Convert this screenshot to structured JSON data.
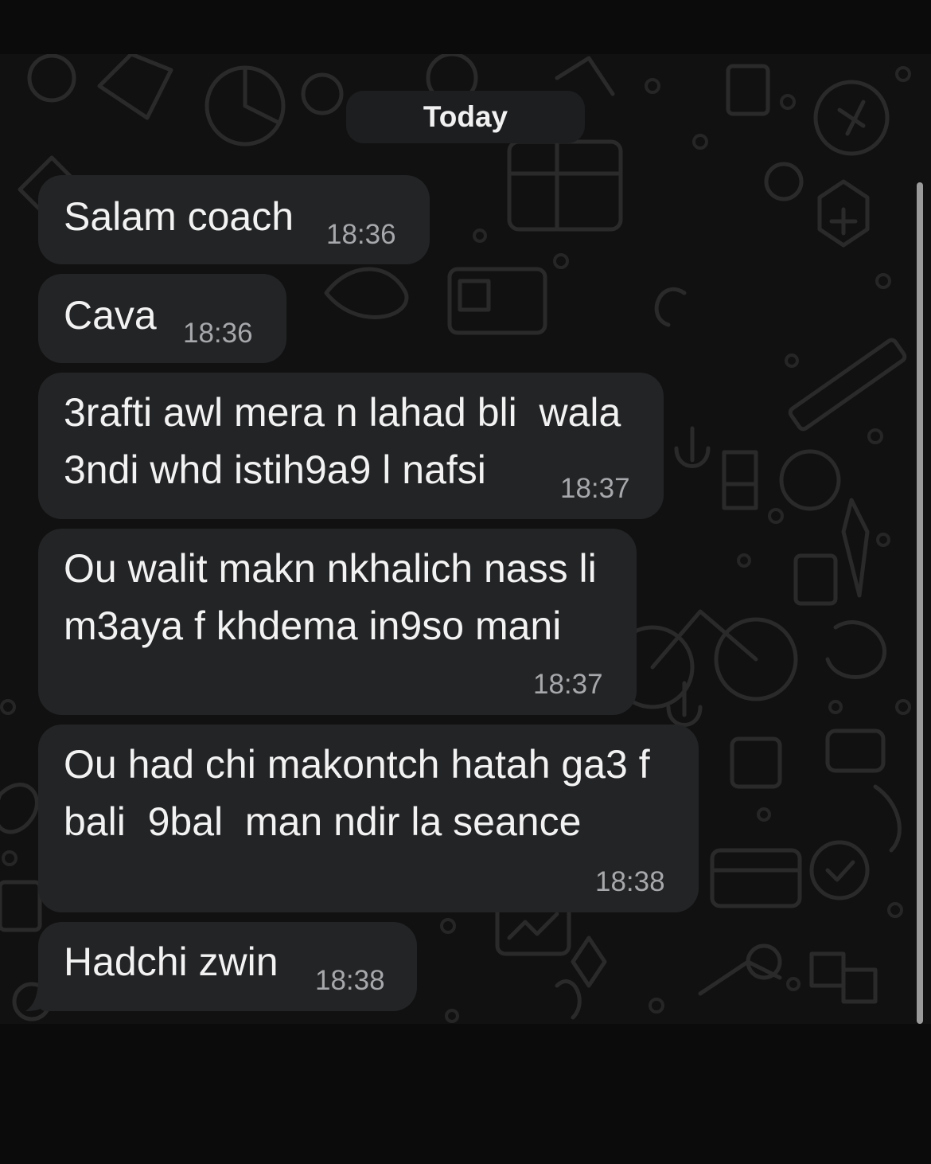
{
  "date_separator": "Today",
  "messages": [
    {
      "lines": [
        "Salam coach"
      ],
      "time": "18:36"
    },
    {
      "lines": [
        "Cava"
      ],
      "time": "18:36"
    },
    {
      "lines": [
        "3rafti awl mera n lahad bli  wala",
        "3ndi whd istih9a9 l nafsi"
      ],
      "time": "18:37"
    },
    {
      "lines": [
        "Ou walit makn nkhalich nass li",
        "m3aya f khdema in9so mani"
      ],
      "time": "18:37"
    },
    {
      "lines": [
        "Ou had chi makontch hatah ga3 f",
        "bali  9bal  man ndir la seance"
      ],
      "time": "18:38"
    },
    {
      "lines": [
        "Hadchi zwin"
      ],
      "time": "18:38"
    }
  ],
  "colors": {
    "background": "#0b0b0b",
    "chat_background": "#111111",
    "bubble": "#232426",
    "text": "#f2f2f2",
    "timestamp": "#a7a8ab"
  }
}
